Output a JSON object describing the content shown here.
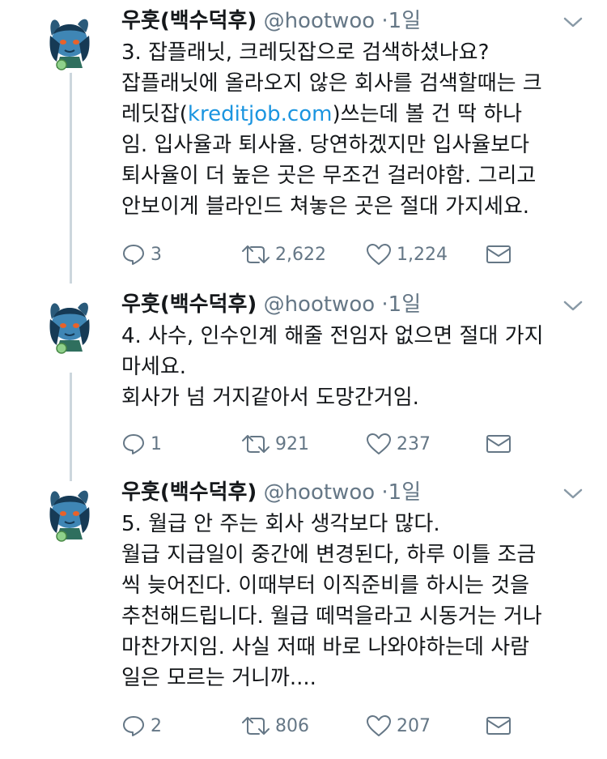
{
  "tweets": [
    {
      "author_name": "우훗(백수덕후)",
      "handle": "@hootwoo",
      "separator": "·",
      "time": "1일",
      "line1": "3. 잡플래닛, 크레딧잡으로 검색하셨나요?",
      "line2": "잡플래닛에 올라오지 않은 회사를 검색할때는 크",
      "line3_pre": "레딧잡(",
      "link": "kreditjob.com",
      "line3_post": ")쓰는데 볼 건 딱 하나",
      "line4": "임. 입사율과 퇴사율. 당연하겠지만 입사율보다",
      "line5": "퇴사율이 더 높은 곳은 무조건 걸러야함. 그리고",
      "line6": "안보이게 블라인드 쳐놓은 곳은 절대 가지세요.",
      "replies": "3",
      "retweets": "2,622",
      "likes": "1,224"
    },
    {
      "author_name": "우훗(백수덕후)",
      "handle": "@hootwoo",
      "separator": "·",
      "time": "1일",
      "line1": "4. 사수, 인수인계 해줄 전임자 없으면 절대 가지",
      "line2": "마세요.",
      "line3": "회사가 넘 거지같아서 도망간거임.",
      "replies": "1",
      "retweets": "921",
      "likes": "237"
    },
    {
      "author_name": "우훗(백수덕후)",
      "handle": "@hootwoo",
      "separator": "·",
      "time": "1일",
      "line1": "5. 월급 안 주는 회사 생각보다 많다.",
      "line2": "월급 지급일이 중간에 변경된다, 하루 이틀 조금",
      "line3": "씩 늦어진다. 이때부터 이직준비를 하시는 것을",
      "line4": "추천해드립니다. 월급 떼먹을라고 시동거는 거나",
      "line5": "마찬가지임. 사실 저때 바로 나와야하는데 사람",
      "line6": "일은 모르는 거니까....",
      "replies": "2",
      "retweets": "806",
      "likes": "207"
    }
  ],
  "icons": {
    "reply": "reply-icon",
    "retweet": "retweet-icon",
    "like": "heart-icon",
    "dm": "envelope-icon",
    "menu": "chevron-down-icon"
  },
  "colors": {
    "text": "#14171a",
    "secondary": "#657786",
    "link": "#1b95e0",
    "thread_line": "#ccd6dd"
  }
}
